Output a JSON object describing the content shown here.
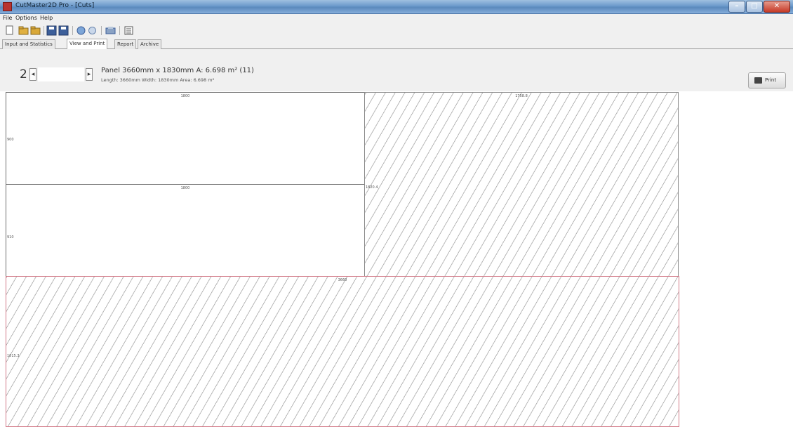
{
  "window": {
    "title": "CutMaster2D Pro - [Cuts]",
    "controls": {
      "minimize": "–",
      "maximize": "□",
      "close": "✕"
    }
  },
  "menu": [
    "File",
    "Options",
    "Help"
  ],
  "toolbar": {
    "buttons": [
      "new-file-icon",
      "open-icon",
      "open-alt-icon",
      "save-icon",
      "save-all-icon",
      "calculate-icon",
      "sheet-icon",
      "export-icon",
      "settings-icon"
    ]
  },
  "tabs": [
    {
      "label": "Input and Statistics",
      "active": false
    },
    {
      "label": "View and Print",
      "active": true
    },
    {
      "label": "Report",
      "active": false
    },
    {
      "label": "Archive",
      "active": false
    }
  ],
  "navigator": {
    "page": "2",
    "prev": "◂",
    "next": "▸",
    "panel_info": "Panel 3660mm x 1830mm A: 6.698 m² (11)",
    "length_info": "Length: 3660mm  Width: 1830mm  Area: 6.698 m²"
  },
  "print_button": {
    "label": "Print"
  },
  "pieces": [
    {
      "type": "cut",
      "top_dim": "1800",
      "left_dim": "900"
    },
    {
      "type": "cut",
      "top_dim": "1800",
      "left_dim": "910"
    },
    {
      "type": "waste",
      "top_dim": "1758.8",
      "left_dim": "1820.4"
    },
    {
      "type": "waste",
      "top_dim": "3660",
      "left_dim": "1015.3"
    }
  ],
  "colors": {
    "titlebar": "#6b9acb",
    "waste_outline": "#d27a88",
    "hatch": "#b8b8b8"
  }
}
